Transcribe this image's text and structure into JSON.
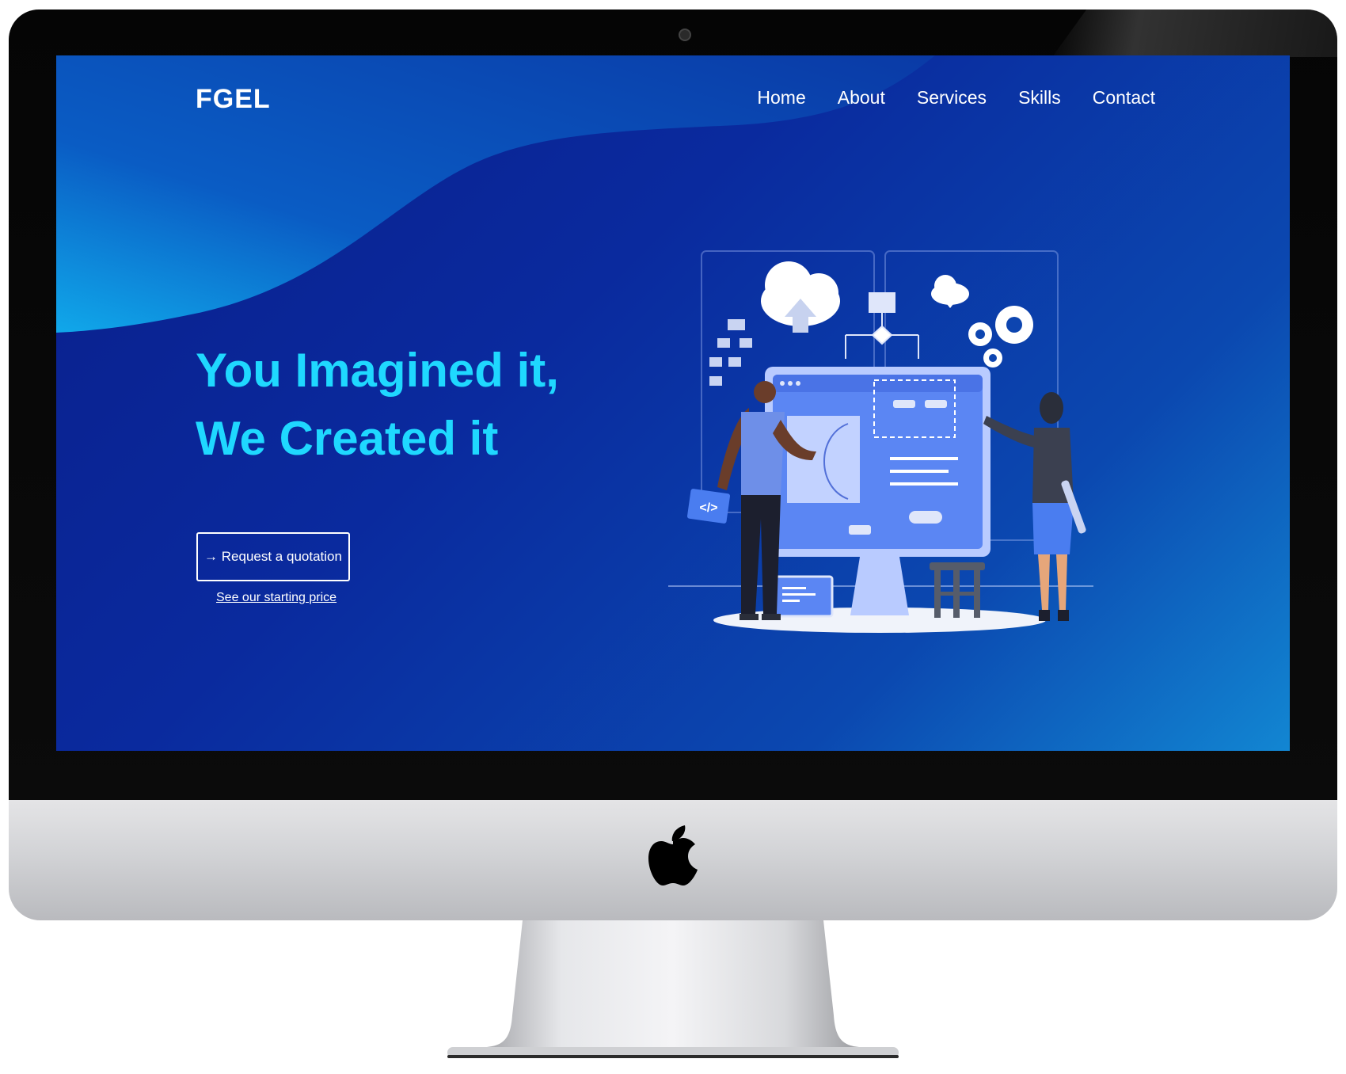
{
  "site": {
    "brand": "FGEL",
    "nav": [
      "Home",
      "About",
      "Services",
      "Skills",
      "Contact"
    ],
    "hero": {
      "line1": "You Imagined it,",
      "line2": "We Created it",
      "cta_label": "→ Request a quotation",
      "secondary_link": "See our starting price"
    },
    "illustration": {
      "code_badge": "</>"
    }
  },
  "colors": {
    "headline": "#1fd8ff",
    "background_dark": "#0a1e8a",
    "background_light": "#1286d2",
    "illustration_blue": "#4a7df0"
  }
}
